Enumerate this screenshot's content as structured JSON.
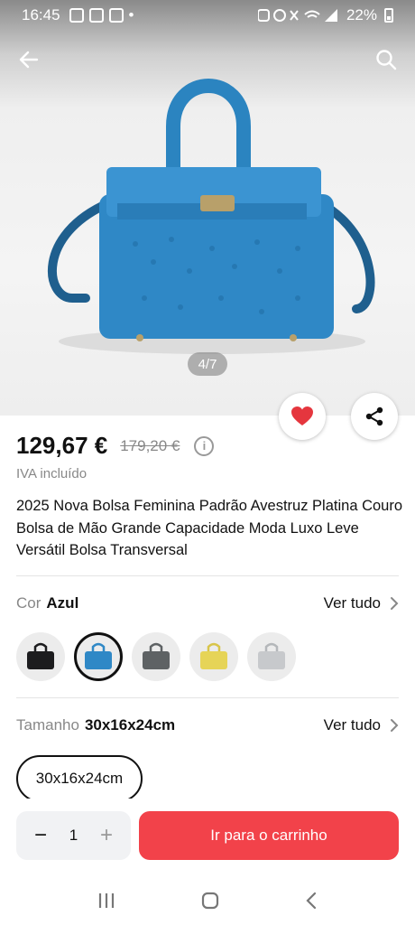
{
  "status_bar": {
    "time": "16:45",
    "battery": "22%"
  },
  "gallery": {
    "counter": "4/7"
  },
  "product": {
    "price": "129,67 €",
    "old_price": "179,20 €",
    "info_glyph": "i",
    "vat_note": "IVA incluído",
    "title": "2025 Nova Bolsa Feminina Padrão Avestruz Platina Couro Bolsa de Mão Grande Capacidade Moda Luxo Leve Versátil Bolsa Transversal"
  },
  "color_option": {
    "label": "Cor",
    "value": "Azul",
    "see_all": "Ver tudo",
    "swatches": [
      "black",
      "blue",
      "grey",
      "yellow",
      "silver"
    ],
    "colors": {
      "black": "#1c1c1e",
      "blue": "#2f88c6",
      "grey": "#5e6264",
      "yellow": "#e6d457",
      "silver": "#c7c9cc"
    }
  },
  "size_option": {
    "label": "Tamanho",
    "value": "30x16x24cm",
    "see_all": "Ver tudo",
    "chips": [
      "30x16x24cm"
    ]
  },
  "purchase": {
    "quantity": "1",
    "minus": "−",
    "plus": "+",
    "cta": "Ir para o carrinho",
    "cta_color": "#f2424a"
  },
  "icons": [
    "back-arrow-icon",
    "search-icon",
    "heart-icon",
    "share-icon",
    "info-icon",
    "chevron-right-icon",
    "recents-icon",
    "home-icon",
    "back-nav-icon"
  ]
}
